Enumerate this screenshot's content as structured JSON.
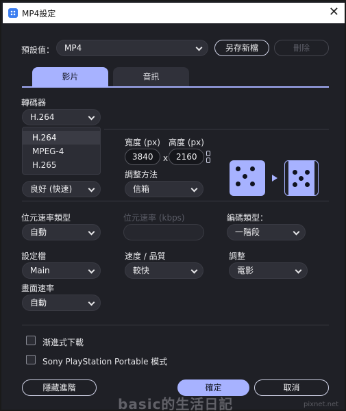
{
  "window": {
    "title": "MP4設定",
    "close_glyph": "✕"
  },
  "preset": {
    "label": "預設值：",
    "value": "MP4",
    "save_new": "另存新檔",
    "delete": "刪除"
  },
  "tabs": [
    {
      "label": "影片",
      "active": true
    },
    {
      "label": "音訊",
      "active": false
    }
  ],
  "encoder": {
    "label": "轉碼器",
    "value": "H.264",
    "options": [
      "H.264",
      "MPEG-4",
      "H.265"
    ],
    "selected_index": 0
  },
  "resolution": {
    "quality_value": "良好 (快速)",
    "width_label": "寬度 (px)",
    "height_label": "高度 (px)",
    "width": "3840",
    "height": "2160",
    "times": "x"
  },
  "resize": {
    "label": "調整方法",
    "value": "信箱"
  },
  "bitrate": {
    "type_label": "位元速率類型",
    "type_value": "自動",
    "rate_label": "位元速率 (kbps)",
    "rate_value": "",
    "encode_label": "編碼類型：",
    "encode_value": "一階段"
  },
  "profile": {
    "label": "設定檔",
    "value": "Main"
  },
  "speed": {
    "label": "速度 / 品質",
    "value": "較快"
  },
  "tune": {
    "label": "調整",
    "value": "電影"
  },
  "framerate": {
    "label": "畫面速率",
    "value": "自動"
  },
  "options": {
    "progressive": "漸進式下載",
    "psp": "Sony PlayStation Portable 模式"
  },
  "footer": {
    "hide_advanced": "隱藏進階",
    "ok": "確定",
    "cancel": "取消"
  },
  "watermark": {
    "main": "basic的生活日記",
    "sub": "pixnet.net"
  },
  "colors": {
    "accent": "#a7b2ff",
    "background": "#1f2026",
    "control": "#2f3038"
  }
}
